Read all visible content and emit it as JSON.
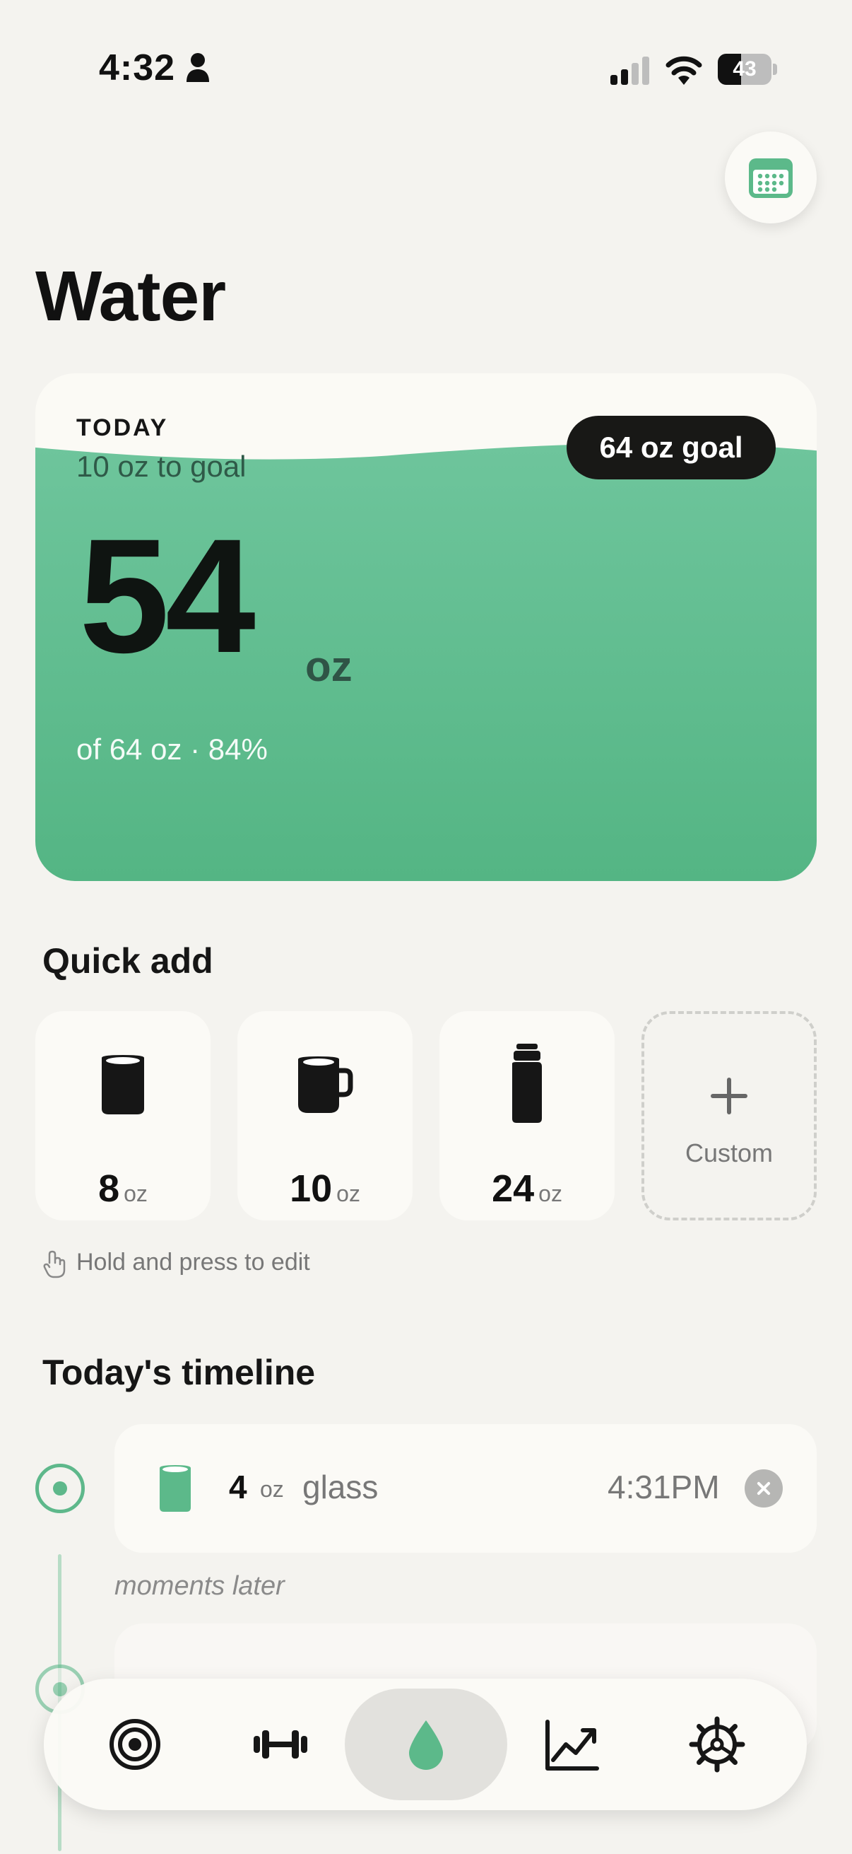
{
  "status_bar": {
    "time": "4:32",
    "battery": "43",
    "battery_level": 0.43
  },
  "page": {
    "title": "Water"
  },
  "hero": {
    "today_label": "TODAY",
    "to_goal": "10 oz to goal",
    "goal_pill": "64 oz goal",
    "amount": "54",
    "unit": "oz",
    "progress_text": "of 64 oz · 84%",
    "progress_fraction": 0.84,
    "accent_color": "#5cb98a"
  },
  "quick_add": {
    "title": "Quick add",
    "items": [
      {
        "amount": "8",
        "unit": "oz",
        "icon": "glass-icon"
      },
      {
        "amount": "10",
        "unit": "oz",
        "icon": "mug-icon"
      },
      {
        "amount": "24",
        "unit": "oz",
        "icon": "bottle-icon"
      }
    ],
    "custom_label": "Custom",
    "hint": "Hold and press to edit"
  },
  "timeline": {
    "title": "Today's timeline",
    "entries": [
      {
        "amount": "4",
        "unit": "oz",
        "name": "glass",
        "time": "4:31PM"
      }
    ],
    "gap_label": "moments later"
  },
  "bottom_nav": {
    "items": [
      "target-icon",
      "dumbbell-icon",
      "water-drop-icon",
      "chart-trend-icon",
      "settings-gear-icon"
    ],
    "active": "water-drop-icon"
  }
}
